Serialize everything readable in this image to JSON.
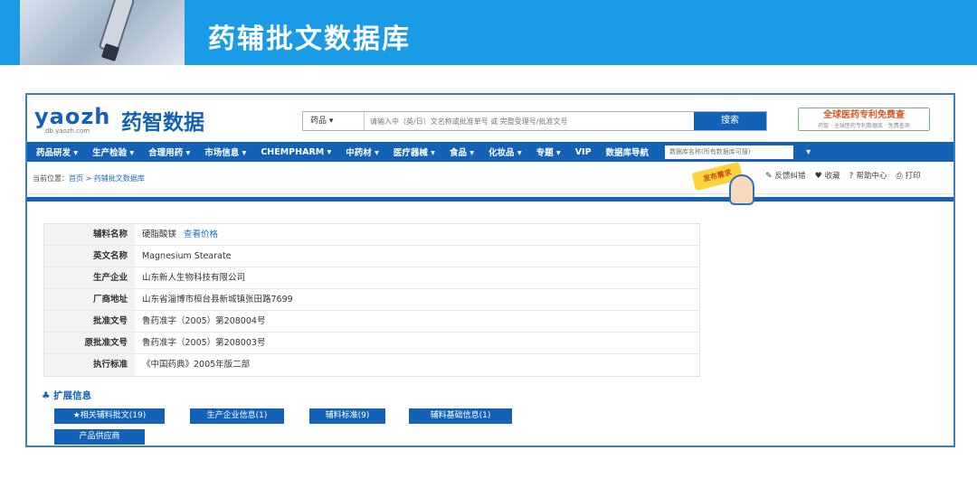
{
  "slide": {
    "title": "药辅批文数据库"
  },
  "site": {
    "logo_latin": "yaozh",
    "logo_cn": "药智数据",
    "logo_url": "db.yaozh.com"
  },
  "search": {
    "category": "药品",
    "placeholder": "请输入中（英/日）文名称或批准单号 或 完整受理号/批准文号",
    "button": "搜索"
  },
  "promo": {
    "main": "全球医药专利免费查",
    "sub": "药智 · 全球医药专利数据库 · 免费查询"
  },
  "nav": {
    "items": [
      "药品研发 ▾",
      "生产检验 ▾",
      "合理用药 ▾",
      "市场信息 ▾",
      "CHEMPHARM ▾",
      "中药材 ▾",
      "医疗器械 ▾",
      "食品 ▾",
      "化妆品 ▾",
      "专题 ▾",
      "VIP",
      "数据库导航"
    ],
    "search_placeholder": "数据库名称(所有数据库可搜)",
    "extra_icon": "▾"
  },
  "breadcrumb": {
    "prefix": "当前位置：",
    "home": "首页",
    "sep": " > ",
    "current": "药辅批文数据库"
  },
  "publish_badge": "发布需求",
  "toolbar": [
    {
      "icon": "✎",
      "label": "反馈纠错"
    },
    {
      "icon": "♥",
      "label": "收藏"
    },
    {
      "icon": "?",
      "label": "帮助中心"
    },
    {
      "icon": "⎙",
      "label": "打印"
    }
  ],
  "detail": [
    {
      "label": "辅料名称",
      "value": "硬脂酸镁",
      "link": "查看价格"
    },
    {
      "label": "英文名称",
      "value": "Magnesium Stearate"
    },
    {
      "label": "生产企业",
      "value": "山东新人生物科技有限公司"
    },
    {
      "label": "厂商地址",
      "value": "山东省淄博市桓台县新城镇张田路7699"
    },
    {
      "label": "批准文号",
      "value": "鲁药准字（2005）第208004号"
    },
    {
      "label": "原批准文号",
      "value": "鲁药准字（2005）第208003号"
    },
    {
      "label": "执行标准",
      "value": "《中国药典》2005年版二部"
    }
  ],
  "extension": {
    "title": "扩展信息",
    "buttons": [
      "★相关辅料批文(19)",
      "生产企业信息(1)",
      "辅料标准(9)",
      "辅料基础信息(1)",
      "产品供应商"
    ]
  }
}
